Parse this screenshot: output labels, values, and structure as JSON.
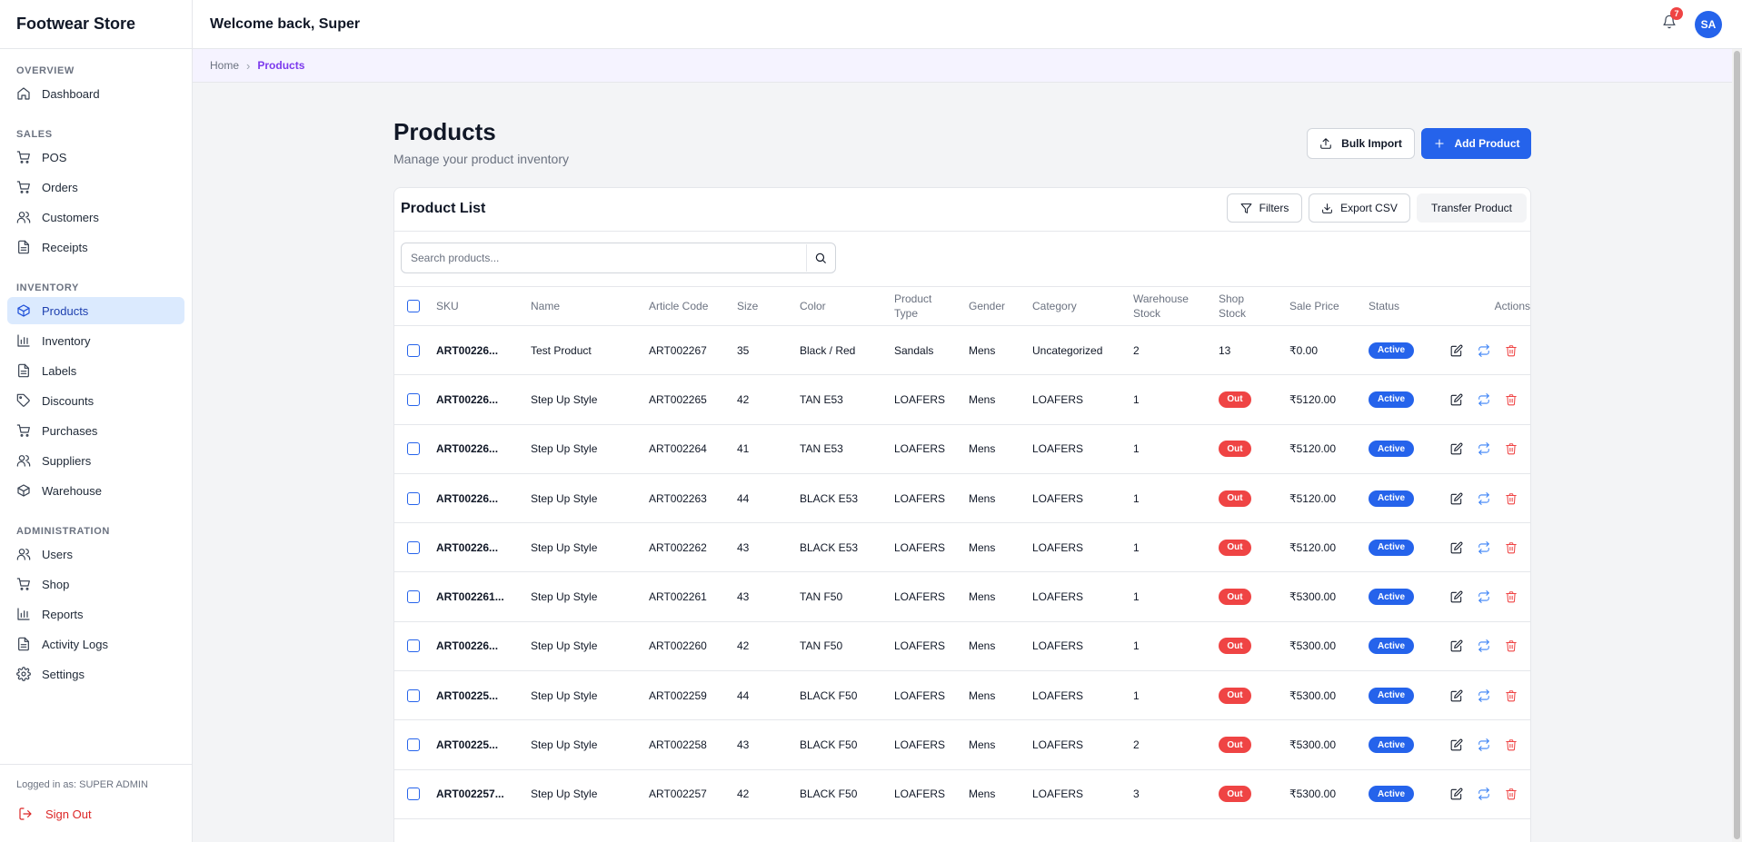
{
  "brand": "Footwear Store",
  "header": {
    "title": "Welcome back, Super",
    "notification_count": "7",
    "avatar_initials": "SA"
  },
  "breadcrumb": {
    "home": "Home",
    "current": "Products"
  },
  "sidebar": {
    "overview_title": "OVERVIEW",
    "overview_items": [
      {
        "label": "Dashboard",
        "icon": "home-icon"
      }
    ],
    "sales_title": "SALES",
    "sales_items": [
      {
        "label": "POS",
        "icon": "cart-icon"
      },
      {
        "label": "Orders",
        "icon": "cart-icon"
      },
      {
        "label": "Customers",
        "icon": "users-icon"
      },
      {
        "label": "Receipts",
        "icon": "file-icon"
      }
    ],
    "inventory_title": "INVENTORY",
    "inventory_items": [
      {
        "label": "Products",
        "icon": "box-icon"
      },
      {
        "label": "Inventory",
        "icon": "bar-chart-icon"
      },
      {
        "label": "Labels",
        "icon": "file-icon"
      },
      {
        "label": "Discounts",
        "icon": "tag-icon"
      },
      {
        "label": "Purchases",
        "icon": "cart-icon"
      },
      {
        "label": "Suppliers",
        "icon": "users-icon"
      },
      {
        "label": "Warehouse",
        "icon": "box-icon"
      }
    ],
    "admin_title": "ADMINISTRATION",
    "admin_items": [
      {
        "label": "Users",
        "icon": "users-icon"
      },
      {
        "label": "Shop",
        "icon": "cart-icon"
      },
      {
        "label": "Reports",
        "icon": "bar-chart-icon"
      },
      {
        "label": "Activity Logs",
        "icon": "file-icon"
      },
      {
        "label": "Settings",
        "icon": "gear-icon"
      }
    ],
    "logged_in": "Logged in as: SUPER ADMIN",
    "sign_out": "Sign Out"
  },
  "page": {
    "title": "Products",
    "subtitle": "Manage your product inventory",
    "bulk_import": "Bulk Import",
    "add_product": "Add Product"
  },
  "card": {
    "title": "Product List",
    "filters": "Filters",
    "export_csv": "Export CSV",
    "transfer_product": "Transfer Product",
    "search_placeholder": "Search products..."
  },
  "table": {
    "headers": {
      "sku": "SKU",
      "name": "Name",
      "article_code": "Article Code",
      "size": "Size",
      "color": "Color",
      "product_type_1": "Product",
      "product_type_2": "Type",
      "gender": "Gender",
      "category": "Category",
      "warehouse_stock_1": "Warehouse",
      "warehouse_stock_2": "Stock",
      "shop_stock_1": "Shop",
      "shop_stock_2": "Stock",
      "sale_price": "Sale Price",
      "status": "Status",
      "actions": "Actions"
    },
    "rows": [
      {
        "sku": "ART00226...",
        "name": "Test Product",
        "article_code": "ART002267",
        "size": "35",
        "color": "Black / Red",
        "type": "Sandals",
        "gender": "Mens",
        "category": "Uncategorized",
        "warehouse": "2",
        "shop": "13",
        "price": "₹0.00",
        "status": "Active"
      },
      {
        "sku": "ART00226...",
        "name": "Step Up Style",
        "article_code": "ART002265",
        "size": "42",
        "color": "TAN E53",
        "type": "LOAFERS",
        "gender": "Mens",
        "category": "LOAFERS",
        "warehouse": "1",
        "shop": "Out",
        "price": "₹5120.00",
        "status": "Active"
      },
      {
        "sku": "ART00226...",
        "name": "Step Up Style",
        "article_code": "ART002264",
        "size": "41",
        "color": "TAN E53",
        "type": "LOAFERS",
        "gender": "Mens",
        "category": "LOAFERS",
        "warehouse": "1",
        "shop": "Out",
        "price": "₹5120.00",
        "status": "Active"
      },
      {
        "sku": "ART00226...",
        "name": "Step Up Style",
        "article_code": "ART002263",
        "size": "44",
        "color": "BLACK E53",
        "type": "LOAFERS",
        "gender": "Mens",
        "category": "LOAFERS",
        "warehouse": "1",
        "shop": "Out",
        "price": "₹5120.00",
        "status": "Active"
      },
      {
        "sku": "ART00226...",
        "name": "Step Up Style",
        "article_code": "ART002262",
        "size": "43",
        "color": "BLACK E53",
        "type": "LOAFERS",
        "gender": "Mens",
        "category": "LOAFERS",
        "warehouse": "1",
        "shop": "Out",
        "price": "₹5120.00",
        "status": "Active"
      },
      {
        "sku": "ART002261...",
        "name": "Step Up Style",
        "article_code": "ART002261",
        "size": "43",
        "color": "TAN F50",
        "type": "LOAFERS",
        "gender": "Mens",
        "category": "LOAFERS",
        "warehouse": "1",
        "shop": "Out",
        "price": "₹5300.00",
        "status": "Active"
      },
      {
        "sku": "ART00226...",
        "name": "Step Up Style",
        "article_code": "ART002260",
        "size": "42",
        "color": "TAN F50",
        "type": "LOAFERS",
        "gender": "Mens",
        "category": "LOAFERS",
        "warehouse": "1",
        "shop": "Out",
        "price": "₹5300.00",
        "status": "Active"
      },
      {
        "sku": "ART00225...",
        "name": "Step Up Style",
        "article_code": "ART002259",
        "size": "44",
        "color": "BLACK F50",
        "type": "LOAFERS",
        "gender": "Mens",
        "category": "LOAFERS",
        "warehouse": "1",
        "shop": "Out",
        "price": "₹5300.00",
        "status": "Active"
      },
      {
        "sku": "ART00225...",
        "name": "Step Up Style",
        "article_code": "ART002258",
        "size": "43",
        "color": "BLACK F50",
        "type": "LOAFERS",
        "gender": "Mens",
        "category": "LOAFERS",
        "warehouse": "2",
        "shop": "Out",
        "price": "₹5300.00",
        "status": "Active"
      },
      {
        "sku": "ART002257...",
        "name": "Step Up Style",
        "article_code": "ART002257",
        "size": "42",
        "color": "BLACK F50",
        "type": "LOAFERS",
        "gender": "Mens",
        "category": "LOAFERS",
        "warehouse": "3",
        "shop": "Out",
        "price": "₹5300.00",
        "status": "Active"
      }
    ]
  },
  "colors": {
    "primary": "#2563eb",
    "danger": "#ef4444",
    "accent_purple": "#7c3aed",
    "active_nav_bg": "#dbeafe"
  }
}
